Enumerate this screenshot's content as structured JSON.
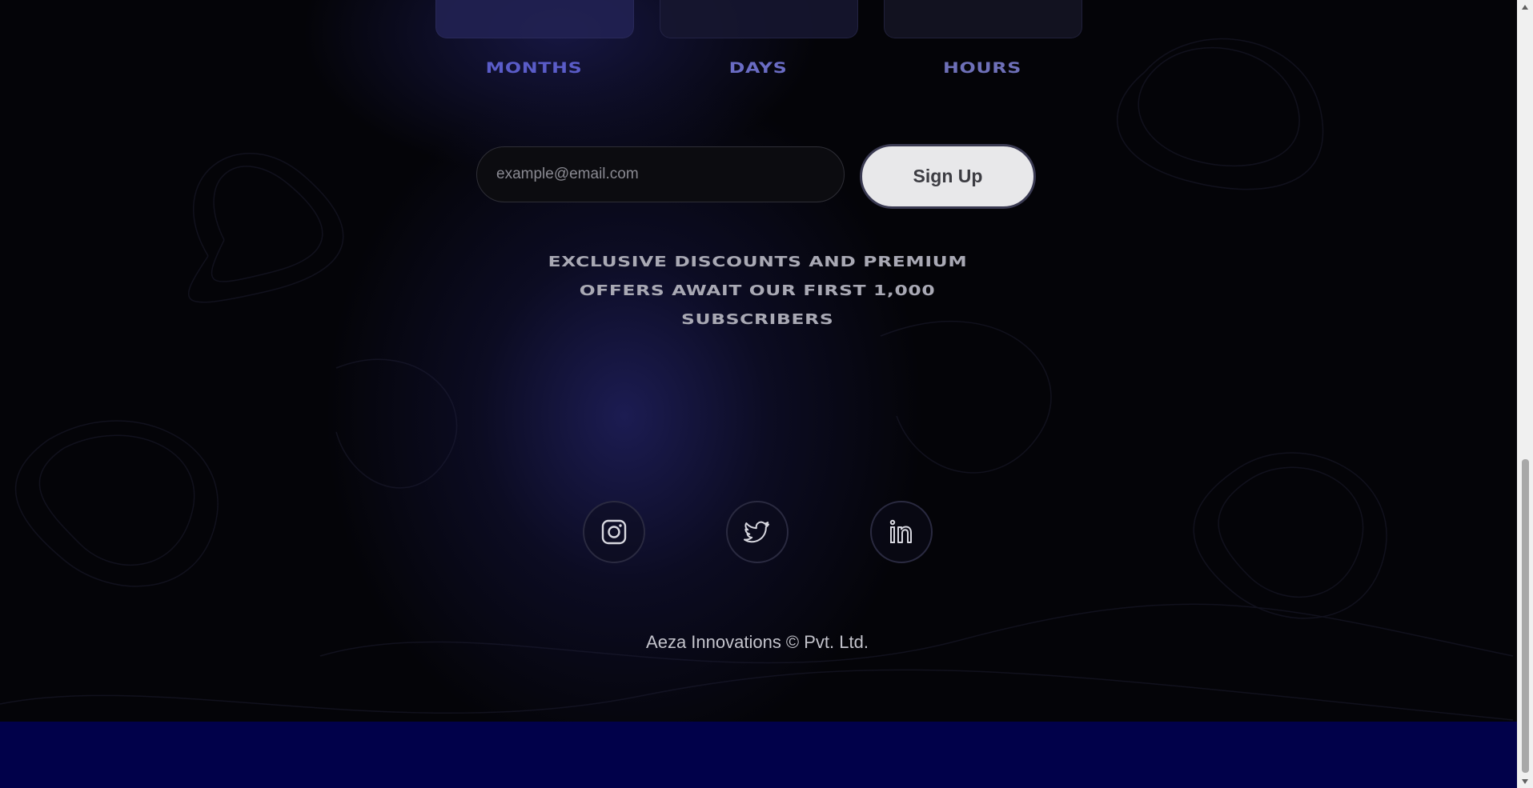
{
  "countdown": {
    "units": [
      {
        "label": "MONTHS"
      },
      {
        "label": "DAYS"
      },
      {
        "label": "HOURS"
      }
    ]
  },
  "signup": {
    "email_placeholder": "example@email.com",
    "button_label": "Sign Up"
  },
  "promo": {
    "line1": "EXCLUSIVE DISCOUNTS AND PREMIUM",
    "line2": "OFFERS AWAIT OUR FIRST 1,000",
    "line3": "SUBSCRIBERS"
  },
  "social": {
    "items": [
      {
        "icon": "instagram-icon"
      },
      {
        "icon": "twitter-icon"
      },
      {
        "icon": "linkedin-icon"
      }
    ]
  },
  "footer": {
    "copyright": "Aeza Innovations © Pvt. Ltd."
  },
  "colors": {
    "background": "#040408",
    "accent_label": "#6466c9",
    "bottom_bar": "#01014a",
    "button_bg": "#e8e8ea"
  }
}
